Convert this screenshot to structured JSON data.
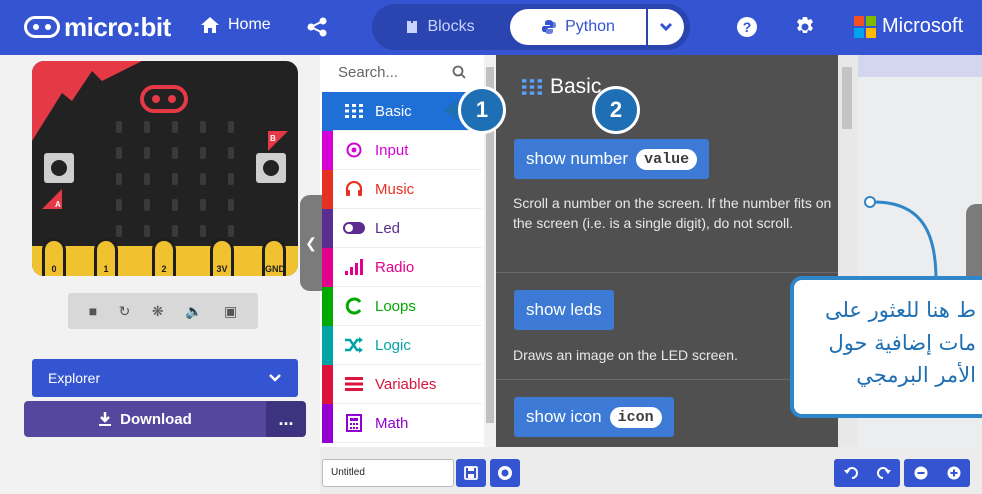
{
  "header": {
    "logo_text": "micro:bit",
    "home_label": "Home",
    "mode_blocks_label": "Blocks",
    "mode_python_label": "Python",
    "brand_label": "Microsoft"
  },
  "simulator": {
    "pins": [
      "0",
      "1",
      "2",
      "3V",
      "GND"
    ],
    "button_a_label": "A",
    "button_b_label": "B",
    "explorer_label": "Explorer"
  },
  "download": {
    "label": "Download",
    "more_label": "..."
  },
  "toolbox": {
    "search_placeholder": "Search...",
    "categories": [
      {
        "label": "Basic",
        "color": "#1e90ff",
        "icon": "grid-icon",
        "selected": true
      },
      {
        "label": "Input",
        "color": "#d400d4",
        "icon": "target-icon"
      },
      {
        "label": "Music",
        "color": "#e63022",
        "icon": "headphones-icon"
      },
      {
        "label": "Led",
        "color": "#5c2d91",
        "icon": "toggle-icon"
      },
      {
        "label": "Radio",
        "color": "#e3008c",
        "icon": "signal-icon"
      },
      {
        "label": "Loops",
        "color": "#00aa00",
        "icon": "loop-icon"
      },
      {
        "label": "Logic",
        "color": "#00a4a6",
        "icon": "shuffle-icon"
      },
      {
        "label": "Variables",
        "color": "#dc143c",
        "icon": "list-icon"
      },
      {
        "label": "Math",
        "color": "#9400d3",
        "icon": "calculator-icon"
      }
    ]
  },
  "flyout": {
    "title": "Basic",
    "blocks": [
      {
        "label": "show number",
        "param": "value",
        "desc": "Scroll a number on the screen. If the number fits on the screen (i.e. is a single digit), do not scroll."
      },
      {
        "label": "show leds",
        "param": "",
        "desc": "Draws an image on the LED screen."
      },
      {
        "label": "show icon",
        "param": "icon",
        "desc": ""
      }
    ]
  },
  "bottom": {
    "project_name": "Untitled"
  },
  "annotations": {
    "badge1": "1",
    "badge2": "2",
    "callout_lines": [
      "ط هنا للعثور على",
      "مات إضافية حول",
      "الأمر البرمجي"
    ]
  },
  "colors": {
    "header_bg": "#3454d1",
    "download_bg": "#54479d",
    "block_bg": "#3d7ad6",
    "annotation": "#1e6fb3"
  }
}
